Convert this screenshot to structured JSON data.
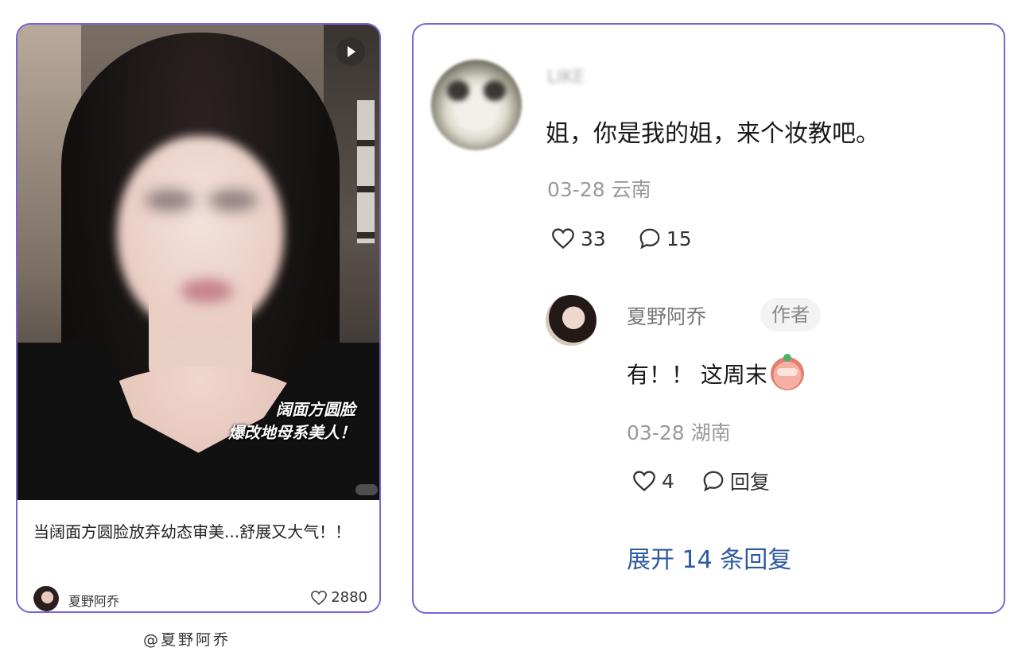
{
  "post": {
    "overlay_line1": "阔面方圆脸",
    "overlay_line2": "爆改地母系美人！",
    "title": "当阔面方圆脸放弃幼态审美...舒展又大气！！",
    "author": "夏野阿乔",
    "likes": "2880"
  },
  "handle": "@夏野阿乔",
  "comment": {
    "username": "LIKE",
    "text": "姐，你是我的姐，来个妆教吧。",
    "date": "03-28",
    "location": "云南",
    "likes": "33",
    "replies": "15"
  },
  "reply": {
    "username": "夏野阿乔",
    "badge": "作者",
    "text": "有！！ 这周末",
    "date": "03-28",
    "location": "湖南",
    "likes": "4",
    "reply_label": "回复"
  },
  "expand_label": "展开 14 条回复",
  "colors": {
    "border": "#7b63d6",
    "link": "#2c5aa0"
  }
}
